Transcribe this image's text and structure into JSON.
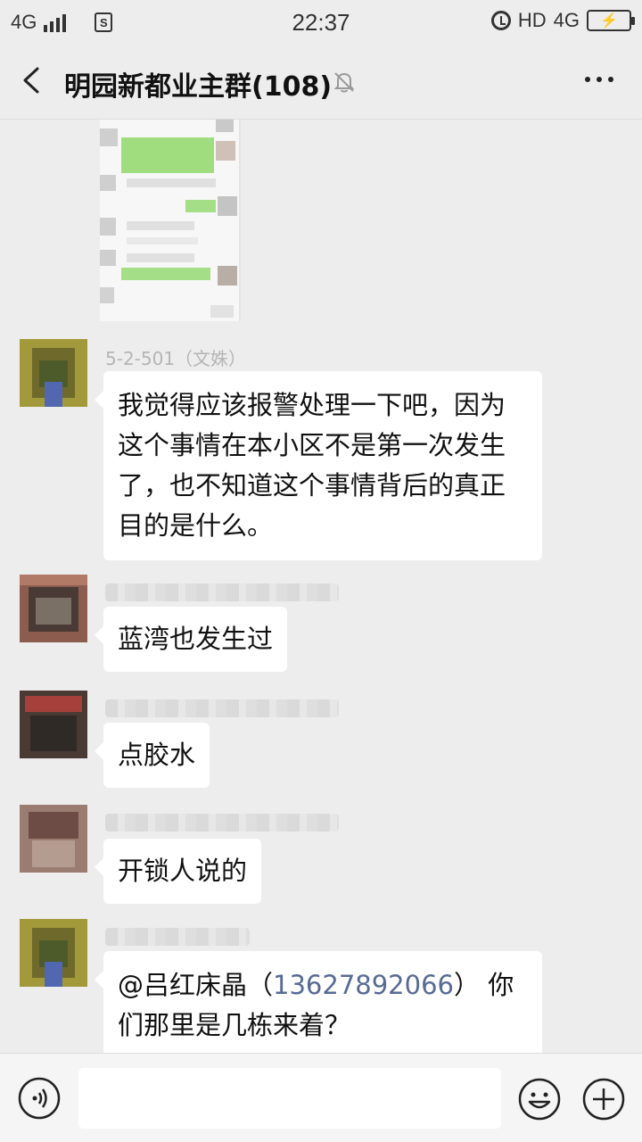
{
  "status_bar": {
    "network_left": "4G",
    "sim_label": "S",
    "time": "22:37",
    "hd_label": "HD",
    "network_right": "4G"
  },
  "nav": {
    "title": "明园新都业主群(108)"
  },
  "messages": [
    {
      "sender": "5-2-501（文姝）",
      "text_lines": [
        "我觉得应该报警处理一下吧，因为",
        "这个事情在本小区不是第一次发生",
        "了，也不知道这个事情背后的真正",
        "目的是什么。"
      ]
    },
    {
      "text": "蓝湾也发生过"
    },
    {
      "text": "点胶水"
    },
    {
      "text": "开锁人说的"
    },
    {
      "mention_prefix": "@吕红床晶（",
      "mention_phone": "13627892066",
      "mention_suffix": "） 你",
      "text_line2": "们那里是几栋来着？"
    }
  ],
  "colors": {
    "background": "#ededed",
    "bubble": "#ffffff",
    "link": "#576b95",
    "sender": "#b5b5b5"
  },
  "icons": [
    "back-arrow-icon",
    "mute-bell-icon",
    "more-dots-icon",
    "voice-icon",
    "emoji-icon",
    "plus-icon"
  ]
}
